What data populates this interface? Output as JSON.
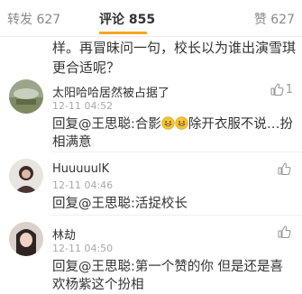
{
  "tabs": {
    "repost": "转发 627",
    "comment": "评论 855",
    "like": "赞 627"
  },
  "top_text": "样。再冒昧问一句，校长以为谁出演雪琪更合适呢？",
  "comments": [
    {
      "username": "太阳哈哈居然被占据了",
      "time": "12-11 04:52",
      "likes": "1",
      "reply_before": "回复@王思聪:合影",
      "reply_after": "除开衣服不说…扮相满意",
      "emoji": [
        "grin-emoji",
        "grin-emoji"
      ]
    },
    {
      "username": "HuuuuulK",
      "time": "12-11 04:46",
      "likes": "",
      "reply": "回复@王思聪:活捉校长"
    },
    {
      "username": "林劫",
      "time": "12-11 04:50",
      "likes": "",
      "reply": "回复@王思聪:第一个赞的你 但是还是喜欢杨紫这个扮相"
    }
  ],
  "colors": {
    "accent_underline": "#f5a623",
    "text_primary": "#333333",
    "text_secondary": "#a8a8a8"
  }
}
